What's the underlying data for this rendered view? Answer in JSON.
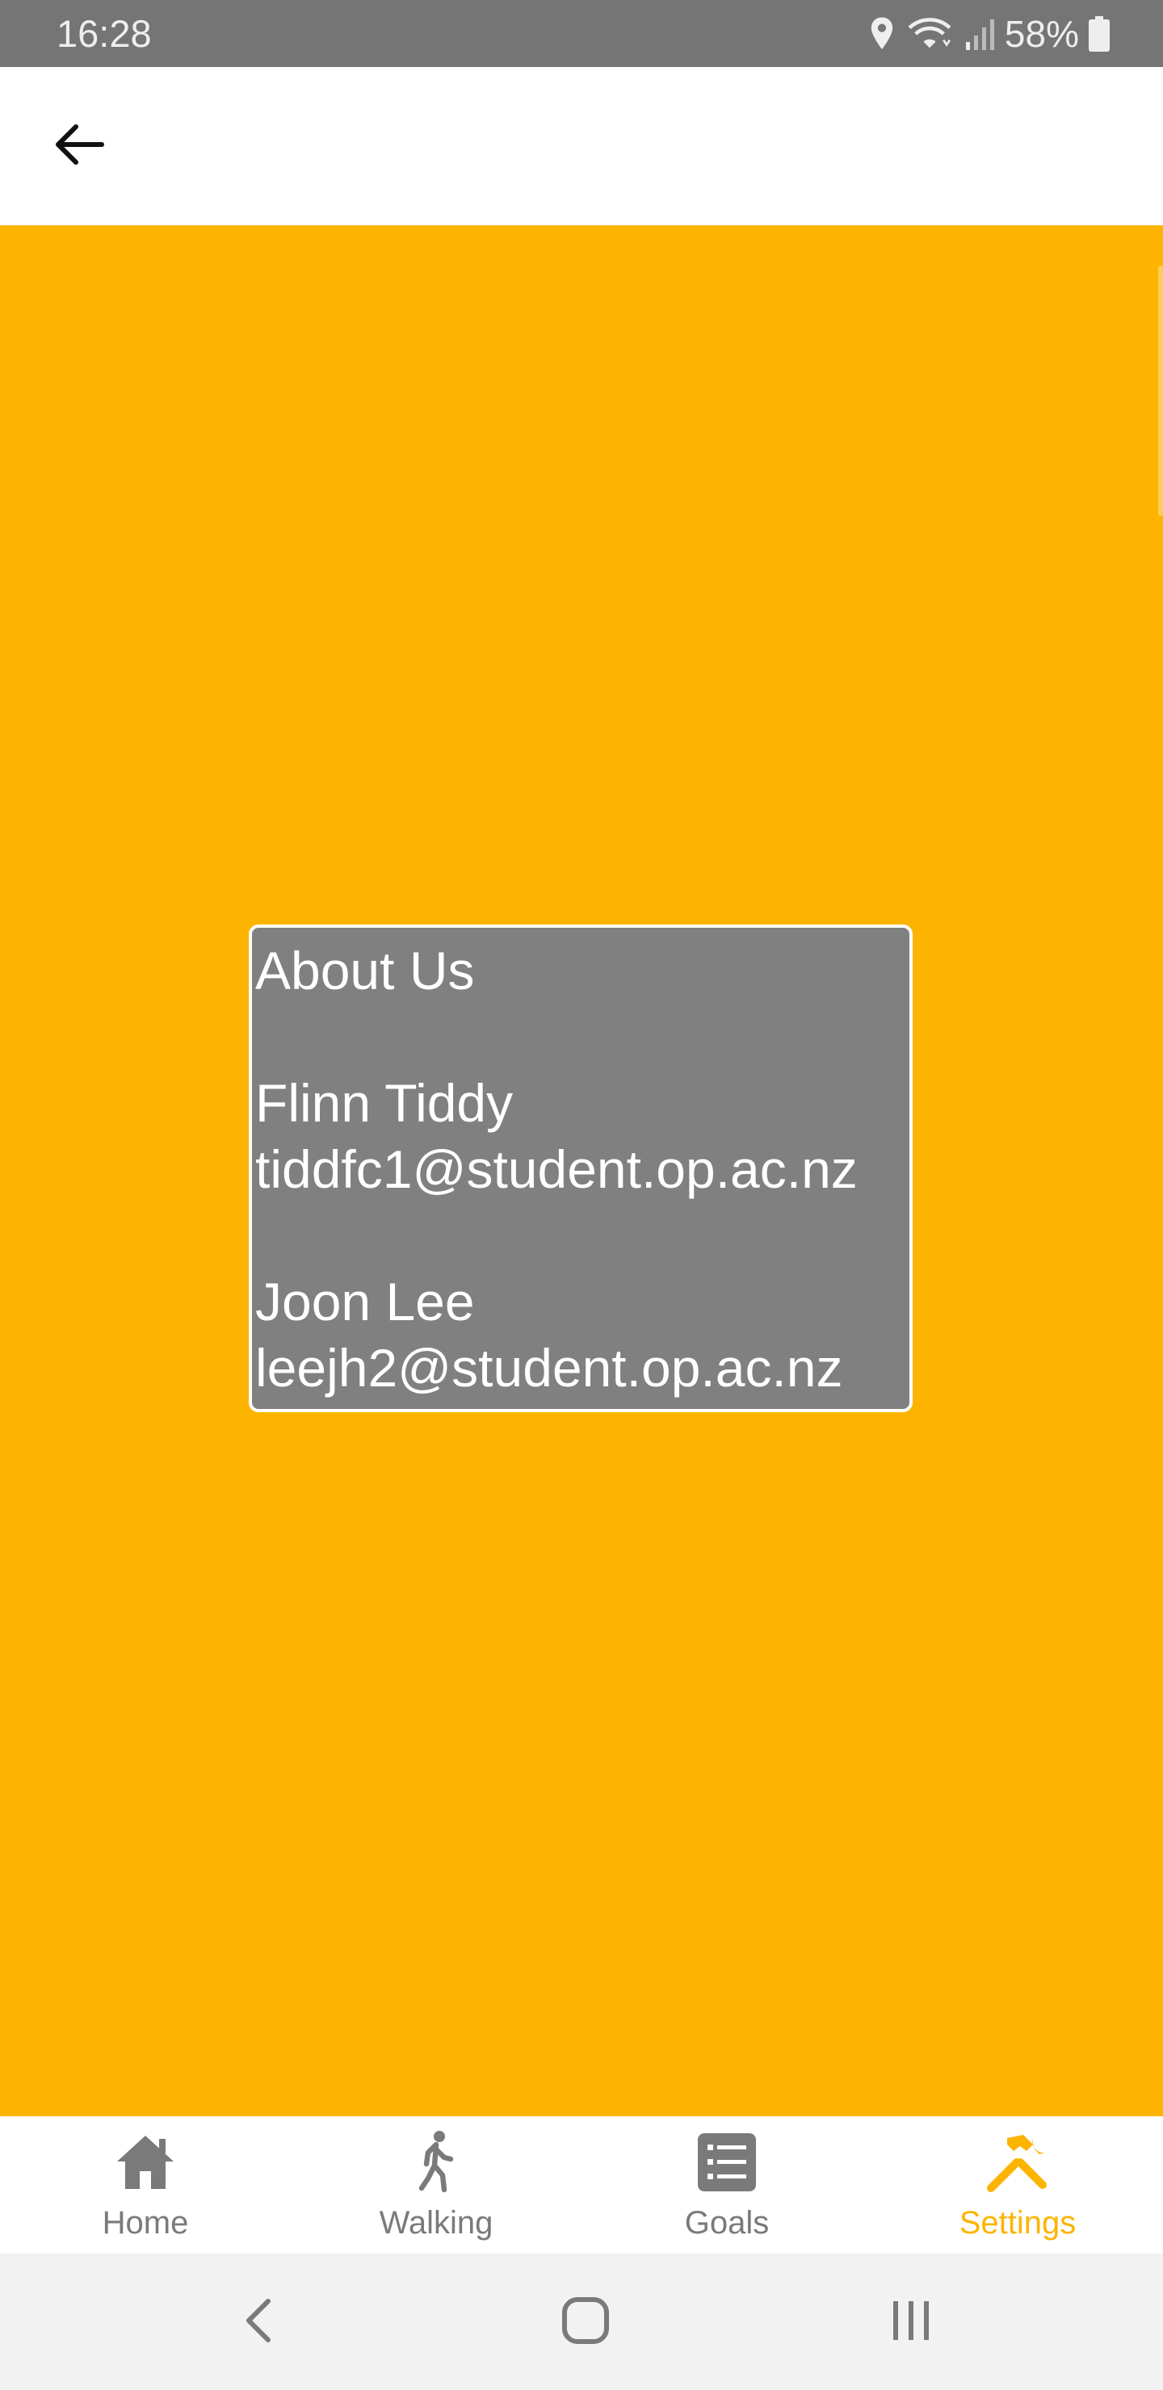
{
  "status_bar": {
    "time": "16:28",
    "battery": "58%",
    "icons": [
      "location-icon",
      "wifi-icon",
      "signal-icon",
      "battery-icon"
    ]
  },
  "app_bar": {
    "back_icon": "arrow-left-icon"
  },
  "about_card": {
    "title": "About Us",
    "members": [
      {
        "name": "Flinn Tiddy",
        "email": "tiddfc1@student.op.ac.nz"
      },
      {
        "name": "Joon Lee",
        "email": "leejh2@student.op.ac.nz"
      }
    ]
  },
  "bottom_nav": {
    "items": [
      {
        "label": "Home",
        "icon": "home-icon",
        "active": false
      },
      {
        "label": "Walking",
        "icon": "walking-icon",
        "active": false
      },
      {
        "label": "Goals",
        "icon": "list-icon",
        "active": false
      },
      {
        "label": "Settings",
        "icon": "tools-icon",
        "active": true
      }
    ]
  },
  "system_nav": {
    "icons": [
      "back-chevron-icon",
      "home-square-icon",
      "recents-icon"
    ]
  },
  "colors": {
    "accent": "#FCB400",
    "card": "#808080",
    "status_bar": "#757575",
    "inactive": "#7a7a7a"
  }
}
